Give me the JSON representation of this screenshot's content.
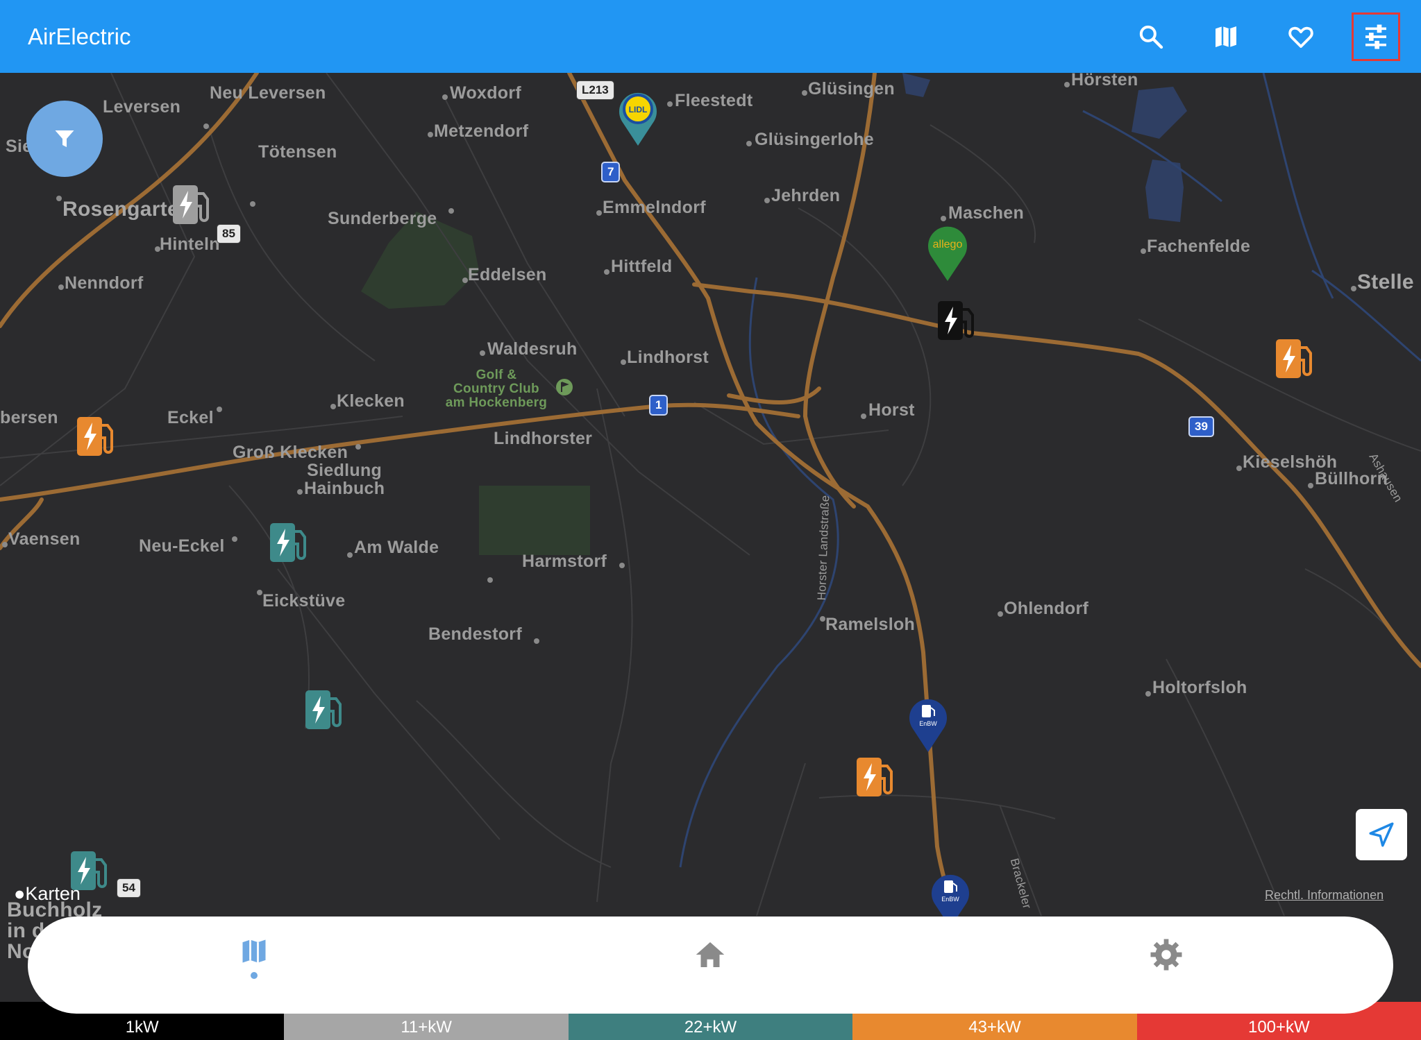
{
  "app_bar": {
    "title": "AirElectric",
    "actions": [
      {
        "name": "search-icon",
        "label": "Search"
      },
      {
        "name": "map-icon",
        "label": "Map"
      },
      {
        "name": "heart-icon",
        "label": "Favorites"
      },
      {
        "name": "tune-icon",
        "label": "Settings"
      }
    ],
    "background": "#2196f3"
  },
  "map": {
    "places": [
      {
        "name": "Neu Leversen"
      },
      {
        "name": "Leversen"
      },
      {
        "name": "Woxdorf"
      },
      {
        "name": "Fleestedt"
      },
      {
        "name": "Glüsingen"
      },
      {
        "name": "Hörsten"
      },
      {
        "name": "Sieversen"
      },
      {
        "name": "Metzendorf"
      },
      {
        "name": "Tötensen"
      },
      {
        "name": "Glüsingerlohe"
      },
      {
        "name": "Rosengarten"
      },
      {
        "name": "Sunderberge"
      },
      {
        "name": "Emmelndorf"
      },
      {
        "name": "Jehrden"
      },
      {
        "name": "Maschen"
      },
      {
        "name": "Hinteln"
      },
      {
        "name": "Fachenfelde"
      },
      {
        "name": "Nenndorf"
      },
      {
        "name": "Eddelsen"
      },
      {
        "name": "Hittfeld"
      },
      {
        "name": "Stelle"
      },
      {
        "name": "Waldesruh"
      },
      {
        "name": "Lindhorst"
      },
      {
        "name": "Golf &\nCountry Club\nam Hockenberg"
      },
      {
        "name": "Klecken"
      },
      {
        "name": "bersen"
      },
      {
        "name": "Eckel"
      },
      {
        "name": "Horst"
      },
      {
        "name": "Lindhorster"
      },
      {
        "name": "Groß Klecken"
      },
      {
        "name": "Siedlung\nHainbuch"
      },
      {
        "name": "Kieselshöh"
      },
      {
        "name": "Büllhorn"
      },
      {
        "name": "Horster Landstraße"
      },
      {
        "name": "Vaensen"
      },
      {
        "name": "Neu-Eckel"
      },
      {
        "name": "Am Walde"
      },
      {
        "name": "Harmstorf"
      },
      {
        "name": "Eickstüve"
      },
      {
        "name": "Ohlendorf"
      },
      {
        "name": "Ramelsloh"
      },
      {
        "name": "Bendestorf"
      },
      {
        "name": "Holtorfsloh"
      },
      {
        "name": "Ashausen"
      },
      {
        "name": "Brackeler"
      },
      {
        "name": "Buchholz\nin der\nNordheide"
      }
    ],
    "road_shields": [
      {
        "label": "L213",
        "style": "white"
      },
      {
        "label": "7",
        "style": "blue"
      },
      {
        "label": "85",
        "style": "white"
      },
      {
        "label": "1",
        "style": "blue"
      },
      {
        "label": "39",
        "style": "blue"
      },
      {
        "label": "54",
        "style": "white"
      }
    ],
    "pins": [
      {
        "brand": "Lidl",
        "label": "LIDL",
        "color": "#3a8f9a"
      },
      {
        "brand": "Allego",
        "label": "allego",
        "color": "#2e8b3a"
      },
      {
        "brand": "EnBW",
        "label": "EnBW",
        "color": "#1e3f8f"
      },
      {
        "brand": "EnBW",
        "label": "EnBW",
        "color": "#1e3f8f"
      }
    ],
    "chargers": [
      {
        "power": "11+kW",
        "color": "#9e9e9e"
      },
      {
        "power": "1kW",
        "color": "#111111"
      },
      {
        "power": "43+kW",
        "color": "#e8892f"
      },
      {
        "power": "43+kW",
        "color": "#e8892f"
      },
      {
        "power": "22+kW",
        "color": "#3e8a8a"
      },
      {
        "power": "22+kW",
        "color": "#3e8a8a"
      },
      {
        "power": "43+kW",
        "color": "#e8892f"
      },
      {
        "power": "22+kW",
        "color": "#3e8a8a"
      }
    ],
    "attribution": "Karten",
    "legal_link": "Rechtl. Informationen"
  },
  "fab": {
    "icon": "filter-icon"
  },
  "locate_button": {
    "icon": "location-arrow-icon"
  },
  "bottom_nav": {
    "items": [
      {
        "icon": "map-icon",
        "selected": true
      },
      {
        "icon": "home-icon",
        "selected": false
      },
      {
        "icon": "gear-icon",
        "selected": false
      }
    ],
    "accent": "#6fa8e2"
  },
  "power_legend": [
    {
      "label": "1kW",
      "color": "#000000"
    },
    {
      "label": "11+kW",
      "color": "#a6a6a6"
    },
    {
      "label": "22+kW",
      "color": "#3e7f7f"
    },
    {
      "label": "43+kW",
      "color": "#e8892f"
    },
    {
      "label": "100+kW",
      "color": "#e53935"
    }
  ]
}
